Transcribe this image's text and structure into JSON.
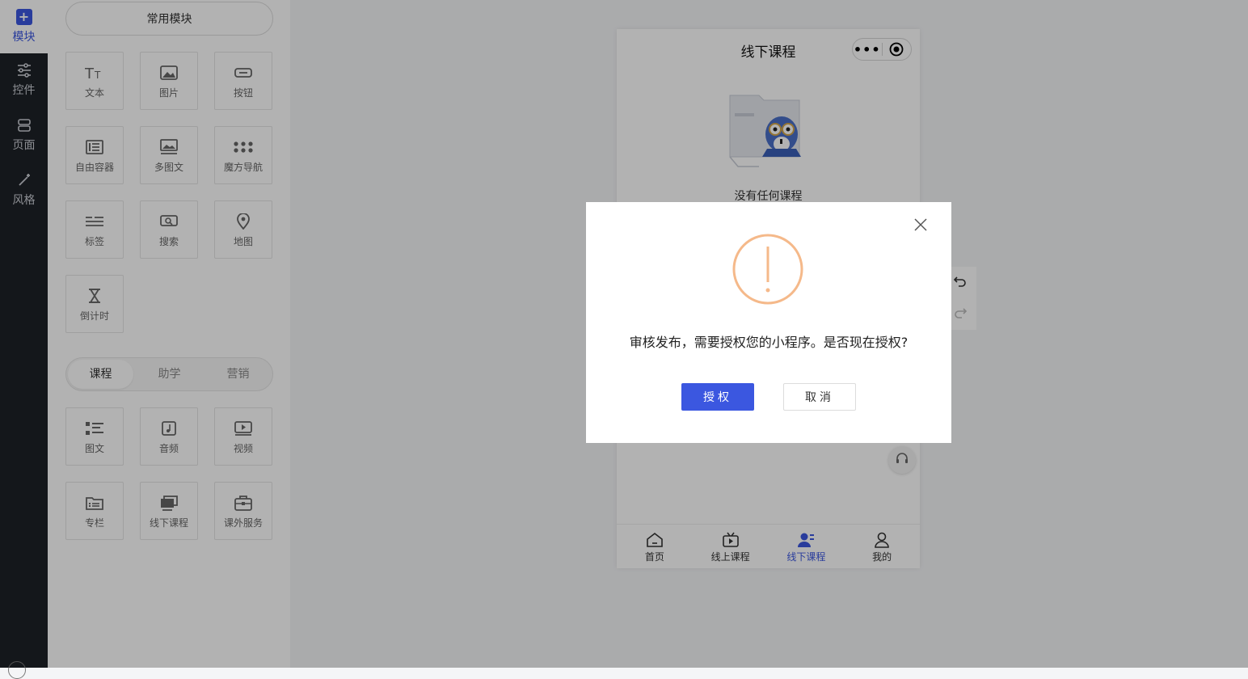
{
  "rail": {
    "items": [
      {
        "label": "模块",
        "icon": "plus-square-icon"
      },
      {
        "label": "控件",
        "icon": "sliders-icon"
      },
      {
        "label": "页面",
        "icon": "server-icon"
      },
      {
        "label": "风格",
        "icon": "magic-wand-icon"
      }
    ]
  },
  "panel": {
    "common_label": "常用模块",
    "tiles": [
      {
        "label": "文本",
        "icon": "text-icon"
      },
      {
        "label": "图片",
        "icon": "image-icon"
      },
      {
        "label": "按钮",
        "icon": "button-icon"
      },
      {
        "label": "自由容器",
        "icon": "container-icon"
      },
      {
        "label": "多图文",
        "icon": "multi-image-icon"
      },
      {
        "label": "魔方导航",
        "icon": "grid-dots-icon"
      },
      {
        "label": "标签",
        "icon": "tags-icon"
      },
      {
        "label": "搜索",
        "icon": "search-icon"
      },
      {
        "label": "地图",
        "icon": "map-pin-icon"
      },
      {
        "label": "倒计时",
        "icon": "hourglass-icon"
      }
    ],
    "tabs": [
      "课程",
      "助学",
      "营销"
    ],
    "course_tiles": [
      {
        "label": "图文",
        "icon": "list-icon"
      },
      {
        "label": "音频",
        "icon": "music-icon"
      },
      {
        "label": "视频",
        "icon": "video-icon"
      },
      {
        "label": "专栏",
        "icon": "folder-icon"
      },
      {
        "label": "线下课程",
        "icon": "offline-course-icon"
      },
      {
        "label": "课外服务",
        "icon": "briefcase-icon"
      }
    ]
  },
  "phone": {
    "title": "线下课程",
    "capsule_dots": "•••",
    "empty_text": "没有任何课程",
    "tabbar": [
      {
        "label": "首页",
        "icon": "home-icon"
      },
      {
        "label": "线上课程",
        "icon": "tv-icon"
      },
      {
        "label": "线下课程",
        "icon": "users-icon",
        "active": true
      },
      {
        "label": "我的",
        "icon": "user-icon"
      }
    ]
  },
  "modal": {
    "message": "审核发布，需要授权您的小程序。是否现在授权?",
    "confirm_label": "授权",
    "cancel_label": "取消"
  },
  "colors": {
    "accent": "#3b57e0",
    "warning": "#f5b98a",
    "rail_bg": "#1e2127"
  }
}
